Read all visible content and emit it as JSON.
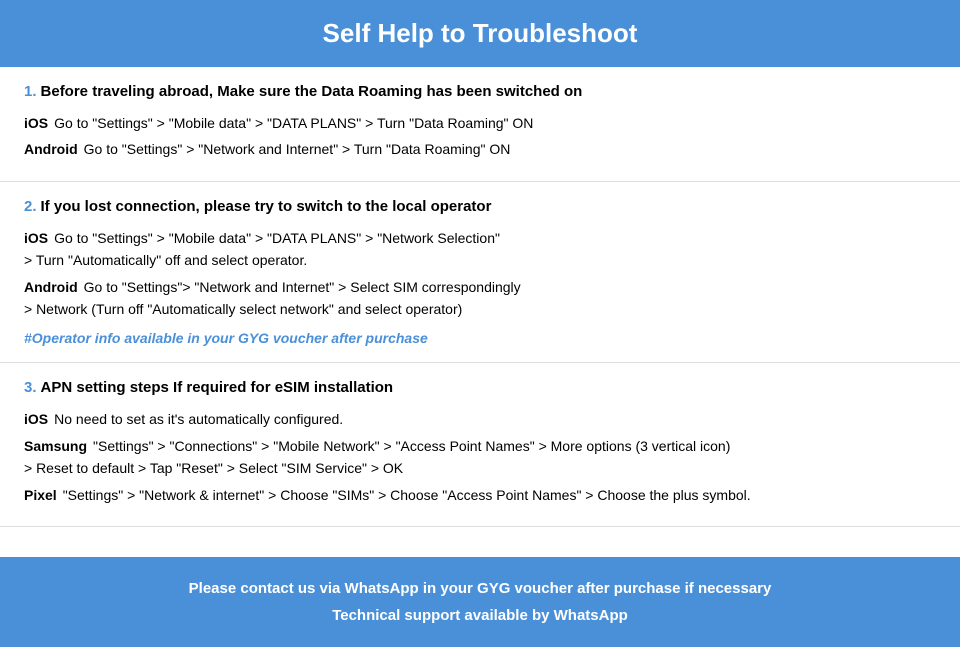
{
  "header": {
    "title": "Self Help to Troubleshoot"
  },
  "sections": [
    {
      "number": "1.",
      "title": "Before traveling abroad, Make sure the Data Roaming has been switched on",
      "items": [
        {
          "platform": "iOS",
          "lines": [
            "Go to \"Settings\" > \"Mobile data\" > \"DATA PLANS\" > Turn \"Data Roaming\" ON"
          ]
        },
        {
          "platform": "Android",
          "lines": [
            "Go to \"Settings\" > \"Network and Internet\" > Turn \"Data Roaming\" ON"
          ]
        }
      ],
      "highlight": null
    },
    {
      "number": "2.",
      "title": "If you lost connection, please try to switch to the local operator",
      "items": [
        {
          "platform": "iOS",
          "lines": [
            "Go to \"Settings\" > \"Mobile data\" > \"DATA PLANS\" > \"Network Selection\"",
            "> Turn \"Automatically\" off and select operator."
          ]
        },
        {
          "platform": "Android",
          "lines": [
            "Go to \"Settings\">  \"Network and Internet\" > Select SIM correspondingly",
            "> Network (Turn off \"Automatically select network\" and select operator)"
          ]
        }
      ],
      "highlight": "#Operator info available in your GYG voucher after purchase"
    },
    {
      "number": "3.",
      "title": "APN setting steps If required for eSIM installation",
      "items": [
        {
          "platform": "iOS",
          "lines": [
            "No need to set as it's automatically configured."
          ]
        },
        {
          "platform": "Samsung",
          "lines": [
            "\"Settings\" > \"Connections\" > \"Mobile Network\" > \"Access Point Names\" > More options (3 vertical icon)",
            "> Reset to default > Tap \"Reset\" > Select \"SIM Service\" > OK"
          ]
        },
        {
          "platform": "Pixel",
          "lines": [
            "\"Settings\" > \"Network & internet\" > Choose \"SIMs\" > Choose \"Access Point Names\" > Choose the plus symbol."
          ]
        }
      ],
      "highlight": null
    }
  ],
  "footer": {
    "line1": "Please contact us via WhatsApp  in your GYG voucher after purchase if necessary",
    "line2": "Technical support available by WhatsApp"
  }
}
